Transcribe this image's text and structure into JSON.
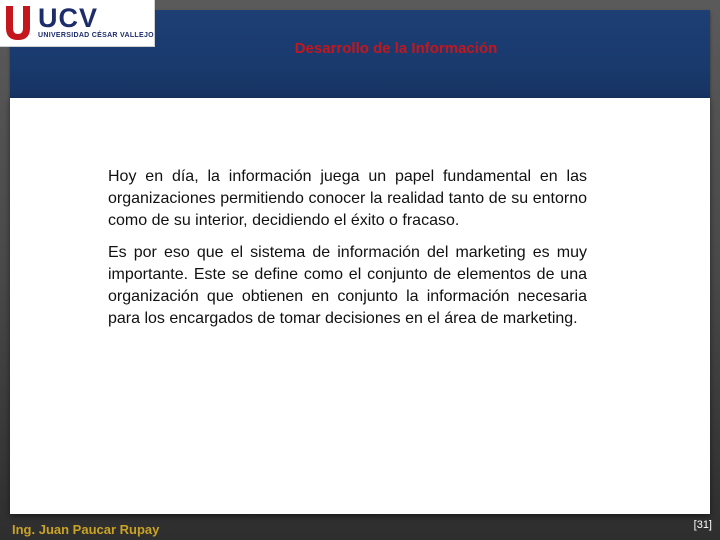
{
  "slide": {
    "title": "Desarrollo de la Información",
    "paragraphs": [
      "Hoy en día, la información juega un papel fundamental en las organizaciones permitiendo conocer la realidad tanto de su entorno como de su interior, decidiendo el éxito o fracaso.",
      "Es por eso que el sistema de información del marketing es muy importante. Este se define como el conjunto de elementos de una organización que obtienen en conjunto la información necesaria para los encargados de tomar decisiones en el área de marketing."
    ]
  },
  "logo": {
    "name": "UCV",
    "subtitle": "UNIVERSIDAD CÉSAR VALLEJO"
  },
  "footer": {
    "author": "Ing. Juan Paucar Rupay",
    "page": "[31]"
  },
  "colors": {
    "header": "#1a3a6e",
    "title": "#c4161c",
    "author": "#c9a227"
  }
}
